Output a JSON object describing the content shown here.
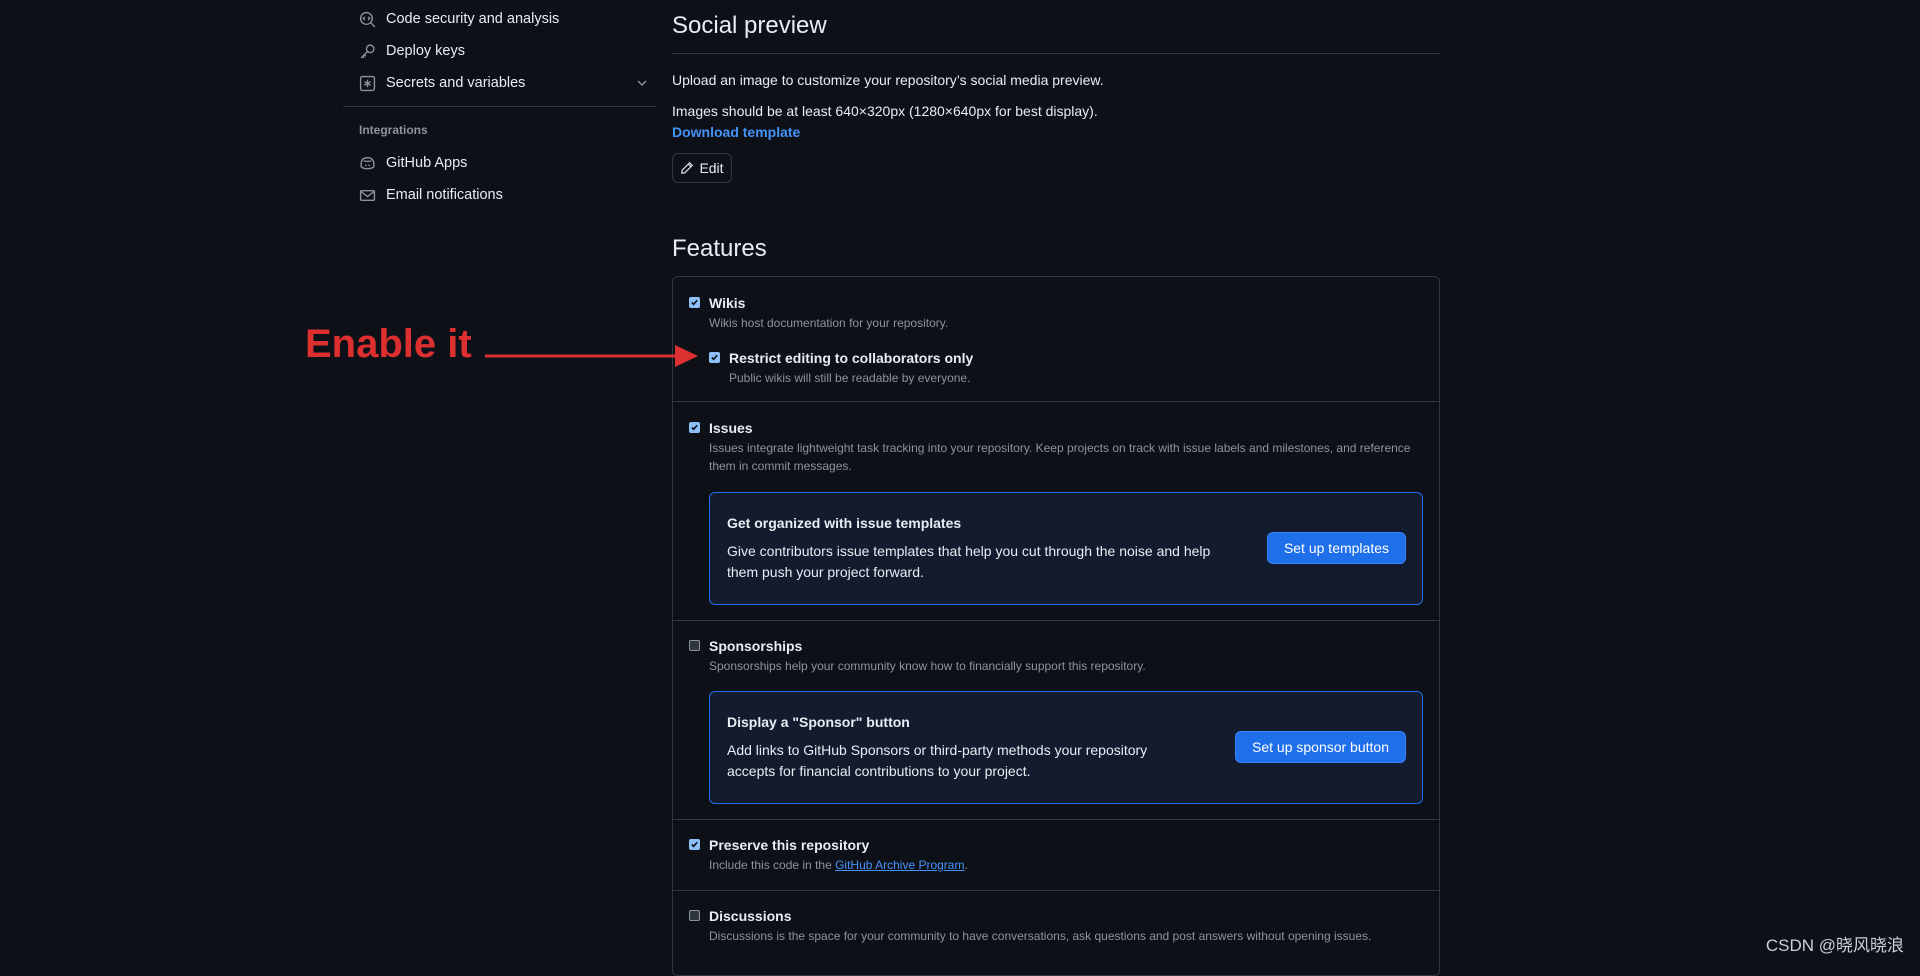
{
  "sidebar": {
    "items": [
      {
        "label": "Code security and analysis",
        "icon": "codescan-icon"
      },
      {
        "label": "Deploy keys",
        "icon": "key-icon"
      },
      {
        "label": "Secrets and variables",
        "icon": "asterisk-icon"
      }
    ],
    "integrations_heading": "Integrations",
    "integrations": [
      {
        "label": "GitHub Apps",
        "icon": "copilot-icon"
      },
      {
        "label": "Email notifications",
        "icon": "mail-icon"
      }
    ]
  },
  "social_preview": {
    "title": "Social preview",
    "description": "Upload an image to customize your repository’s social media preview.",
    "size_hint": "Images should be at least 640×320px (1280×640px for best display).",
    "download_link": "Download template",
    "edit_label": "Edit"
  },
  "features": {
    "title": "Features",
    "wikis": {
      "label": "Wikis",
      "desc": "Wikis host documentation for your repository.",
      "checked": true
    },
    "restrict": {
      "label": "Restrict editing to collaborators only",
      "desc": "Public wikis will still be readable by everyone.",
      "checked": true
    },
    "issues": {
      "label": "Issues",
      "desc_line1": "Issues integrate lightweight task tracking into your repository. Keep projects on track with issue labels and milestones, and reference",
      "desc_line2": "them in commit messages.",
      "checked": true
    },
    "issue_templates": {
      "title": "Get organized with issue templates",
      "desc_line1": "Give contributors issue templates that help you cut through the noise and help",
      "desc_line2": "them push your project forward.",
      "button": "Set up templates"
    },
    "sponsorships": {
      "label": "Sponsorships",
      "desc": "Sponsorships help your community know how to financially support this repository.",
      "checked": false
    },
    "sponsor_button": {
      "title": "Display a \"Sponsor\" button",
      "desc_line1": "Add links to GitHub Sponsors or third-party methods your repository",
      "desc_line2": "accepts for financial contributions to your project.",
      "button": "Set up sponsor button"
    },
    "preserve": {
      "label": "Preserve this repository",
      "desc_prefix": "Include this code in the ",
      "desc_link": "GitHub Archive Program",
      "desc_suffix": ".",
      "checked": true
    },
    "discussions": {
      "label": "Discussions",
      "desc": "Discussions is the space for your community to have conversations, ask questions and post answers without opening issues.",
      "checked": false
    }
  },
  "annotation": {
    "text": "Enable it",
    "color": "#dc2f2f"
  },
  "watermark": "CSDN @晓风晓浪",
  "colors": {
    "background": "#0d1117",
    "accent": "#1f6feb",
    "link": "#4493f8",
    "border": "#30363d"
  }
}
